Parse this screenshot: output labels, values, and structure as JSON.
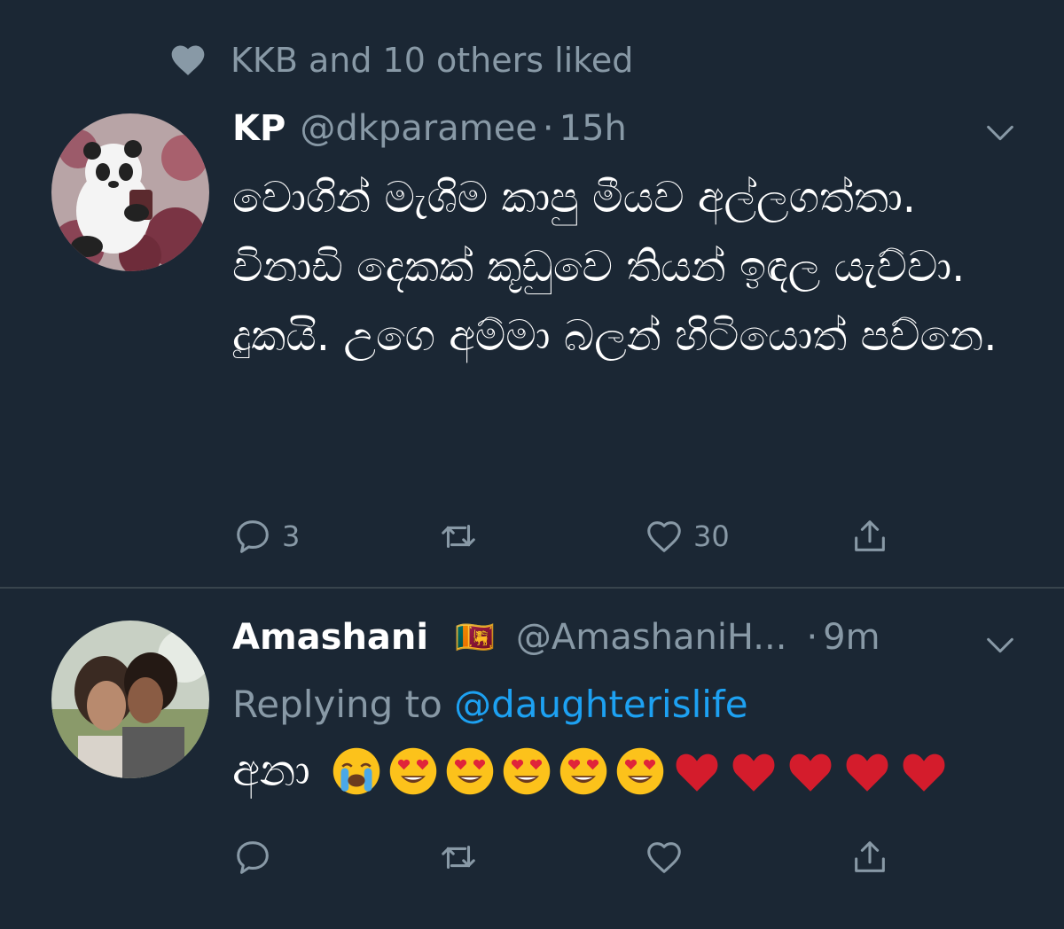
{
  "social_context": {
    "text": "KKB and 10 others liked"
  },
  "tweets": [
    {
      "name": "KP",
      "handle": "@dkparamee",
      "dot": "·",
      "time": "15h",
      "text": "වොගින් මැශිම කාපු මීයව අල්ලගත්තා. විනාඩි දෙකක් කූඩුවෙ තියන් ඉඳල යැව්වා. දුකයි. උගෙ අම්මා බලන් හිටියොත් පව්නෙ.",
      "actions": {
        "reply_count": "3",
        "retweet_count": "",
        "like_count": "30"
      }
    },
    {
      "name": "Amashani",
      "flag": "🇱🇰",
      "handle": "@AmashaniH...",
      "dot": "·",
      "time": "9m",
      "replying_to_label": "Replying to",
      "replying_to_mention": "@daughterislife",
      "text": "අනා",
      "emojis": [
        "crying-face",
        "heart-eyes",
        "heart-eyes",
        "heart-eyes",
        "heart-eyes",
        "heart-eyes",
        "red-heart",
        "red-heart",
        "red-heart",
        "red-heart",
        "red-heart"
      ],
      "actions": {
        "reply_count": "",
        "retweet_count": "",
        "like_count": ""
      }
    }
  ],
  "colors": {
    "background": "#1b2734",
    "secondary_text": "#8899a6",
    "link": "#1da1f2",
    "divider": "#38444d"
  }
}
